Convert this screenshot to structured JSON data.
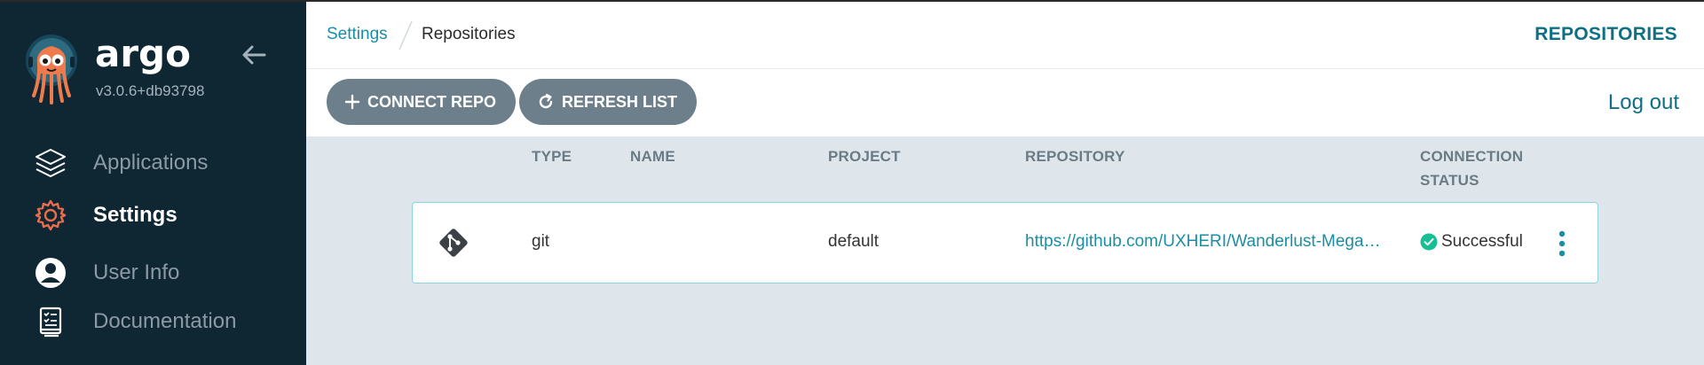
{
  "sidebar": {
    "brand": "argo",
    "version": "v3.0.6+db93798",
    "items": [
      {
        "label": "Applications",
        "icon": "layers-icon",
        "active": false
      },
      {
        "label": "Settings",
        "icon": "gear-icon",
        "active": true
      },
      {
        "label": "User Info",
        "icon": "user-icon",
        "active": false
      },
      {
        "label": "Documentation",
        "icon": "book-icon",
        "active": false
      }
    ]
  },
  "header": {
    "breadcrumb": [
      "Settings",
      "Repositories"
    ],
    "title": "REPOSITORIES"
  },
  "toolbar": {
    "connect_label": "CONNECT REPO",
    "refresh_label": "REFRESH LIST",
    "logout_label": "Log out"
  },
  "table": {
    "columns": {
      "type": "TYPE",
      "name": "NAME",
      "project": "PROJECT",
      "repository": "REPOSITORY",
      "status_line1": "CONNECTION",
      "status_line2": "STATUS"
    },
    "rows": [
      {
        "type": "git",
        "name": "",
        "project": "default",
        "repository": "https://github.com/UXHERI/Wanderlust-Mega-Project",
        "status": "Successful"
      }
    ]
  },
  "colors": {
    "sidebar_bg": "#0f2733",
    "accent": "#1a8ea6",
    "accent_dark": "#0f6f84",
    "button_bg": "#6d7f8b",
    "success": "#18be94",
    "settings_icon": "#e96d4c"
  }
}
